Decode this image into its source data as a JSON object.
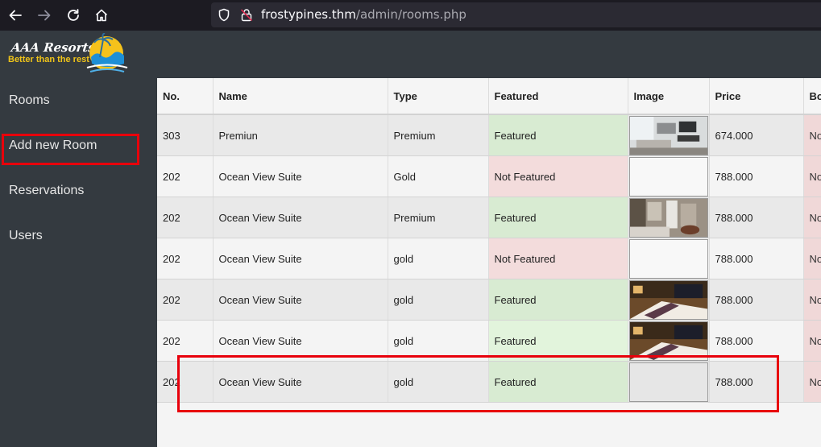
{
  "browser": {
    "url_host": "frostypines.thm",
    "url_path": "/admin/rooms.php"
  },
  "brand": {
    "title": "AAA Resorts",
    "tagline": "Better than the rest"
  },
  "sidebar": {
    "items": [
      {
        "label": "Rooms"
      },
      {
        "label": "Add new Room"
      },
      {
        "label": "Reservations"
      },
      {
        "label": "Users"
      }
    ]
  },
  "table": {
    "headers": [
      "No.",
      "Name",
      "Type",
      "Featured",
      "Image",
      "Price",
      "Bo"
    ],
    "rows": [
      {
        "no": "303",
        "name": "Premiun",
        "type": "Premium",
        "featured": "Featured",
        "price": "674.000",
        "bo": "No"
      },
      {
        "no": "202",
        "name": "Ocean View Suite",
        "type": "Gold",
        "featured": "Not Featured",
        "price": "788.000",
        "bo": "No"
      },
      {
        "no": "202",
        "name": "Ocean View Suite",
        "type": "Premium",
        "featured": "Featured",
        "price": "788.000",
        "bo": "No"
      },
      {
        "no": "202",
        "name": "Ocean View Suite",
        "type": "gold",
        "featured": "Not Featured",
        "price": "788.000",
        "bo": "No"
      },
      {
        "no": "202",
        "name": "Ocean View Suite",
        "type": "gold",
        "featured": "Featured",
        "price": "788.000",
        "bo": "No"
      },
      {
        "no": "202",
        "name": "Ocean View Suite",
        "type": "gold",
        "featured": "Featured",
        "price": "788.000",
        "bo": "No"
      },
      {
        "no": "202",
        "name": "Ocean View Suite",
        "type": "gold",
        "featured": "Featured",
        "price": "788.000",
        "bo": "No"
      }
    ]
  },
  "colors": {
    "highlight": "#e8000b",
    "sidebar_bg": "#343a40",
    "featured_bg": "#d8ebd2",
    "not_featured_bg": "#f3dcdc"
  }
}
